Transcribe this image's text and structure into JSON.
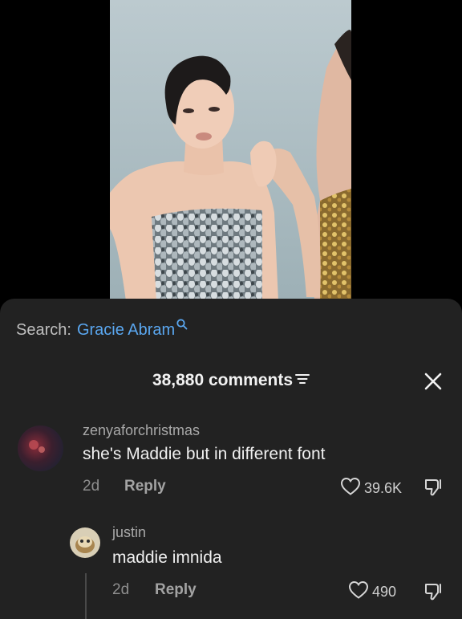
{
  "search": {
    "label": "Search:",
    "term": "Gracie Abram"
  },
  "comments_header": {
    "count_label": "38,880 comments"
  },
  "comments": [
    {
      "username": "zenyaforchristmas",
      "text": "she's Maddie but in different font",
      "age": "2d",
      "reply_label": "Reply",
      "likes": "39.6K"
    },
    {
      "username": "justin",
      "text": "maddie imnida",
      "age": "2d",
      "reply_label": "Reply",
      "likes": "490"
    }
  ],
  "colors": {
    "sheet_bg": "#222222",
    "search_term": "#5aa7f0",
    "primary_text": "#f0f0f0",
    "secondary_text": "#a8a8a8"
  },
  "icons": [
    "search-icon",
    "filter-icon",
    "close-icon",
    "heart-icon",
    "dislike-icon"
  ]
}
